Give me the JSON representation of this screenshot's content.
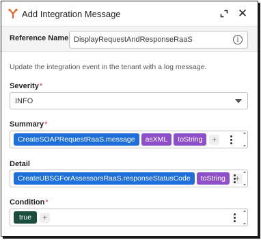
{
  "header": {
    "title": "Add Integration Message",
    "logo_icon": "workday-integration-icon",
    "expand_icon": "expand-icon",
    "close_icon": "close-icon",
    "close_glyph": "✕"
  },
  "reference": {
    "label": "Reference Name",
    "required_marker": "*",
    "value": "DisplayRequestAndResponseRaaS",
    "info_glyph": "i"
  },
  "description": "Update the integration event in the tenant with a log message.",
  "severity": {
    "label": "Severity",
    "required_marker": "*",
    "selected": "INFO"
  },
  "summary": {
    "label": "Summary",
    "required_marker": "*",
    "tokens": [
      "CreateSOAPRequestRaaS.message",
      "asXML",
      "toString"
    ],
    "add_glyph": "+"
  },
  "detail": {
    "label": "Detail",
    "tokens": [
      "CreateUBSGForAssessorsRaaS.responseStatusCode",
      "toString"
    ],
    "add_glyph": "+"
  },
  "condition": {
    "label": "Condition",
    "required_marker": "*",
    "tokens": [
      "true"
    ],
    "add_glyph": "+"
  },
  "colors": {
    "object_pill": "#1e6fd9",
    "method_pill": "#8f4fc9",
    "boolean_pill": "#1a4d3e",
    "required": "#d93025"
  }
}
